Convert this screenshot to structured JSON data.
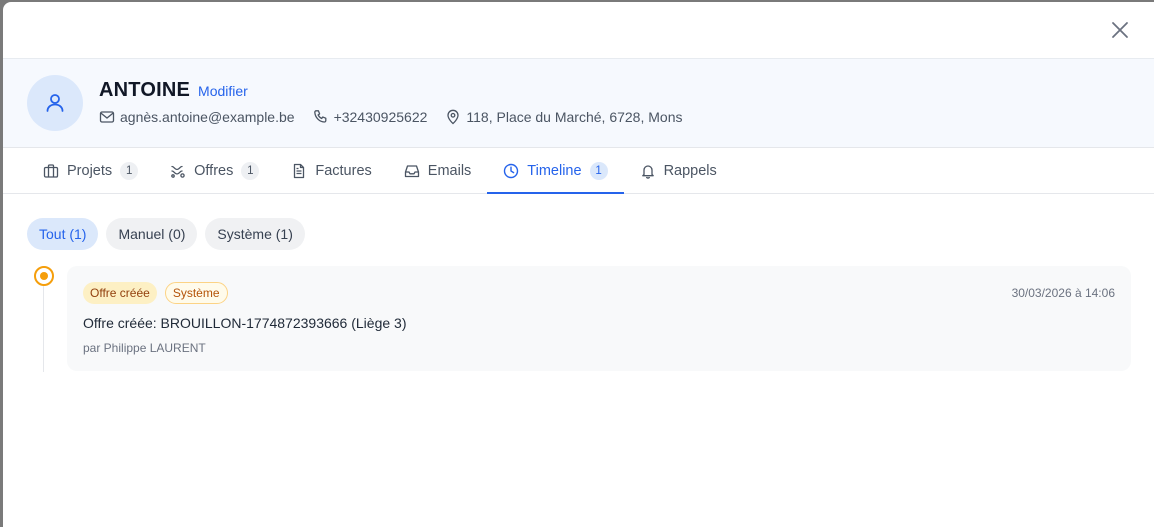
{
  "client": {
    "name": "ANTOINE",
    "edit_label": "Modifier",
    "email": "agnès.antoine@example.be",
    "phone": "+32430925622",
    "address": "118, Place du Marché, 6728, Mons"
  },
  "tabs": [
    {
      "label": "Projets",
      "count": "1",
      "icon": "briefcase-icon"
    },
    {
      "label": "Offres",
      "count": "1",
      "icon": "offers-icon"
    },
    {
      "label": "Factures",
      "count": "",
      "icon": "document-icon"
    },
    {
      "label": "Emails",
      "count": "",
      "icon": "inbox-icon"
    },
    {
      "label": "Timeline",
      "count": "1",
      "icon": "clock-icon",
      "active": true
    },
    {
      "label": "Rappels",
      "count": "",
      "icon": "bell-icon"
    }
  ],
  "filters": [
    {
      "label": "Tout (1)",
      "active": true
    },
    {
      "label": "Manuel (0)"
    },
    {
      "label": "Système (1)"
    }
  ],
  "events": [
    {
      "type_badge": "Offre créée",
      "source_badge": "Système",
      "date": "30/03/2026 à 14:06",
      "title": "Offre créée: BROUILLON-1774872393666 (Liège 3)",
      "author": "par Philippe LAURENT"
    }
  ],
  "colors": {
    "accent": "#2563eb",
    "timeline_dot": "#f59e0b"
  }
}
